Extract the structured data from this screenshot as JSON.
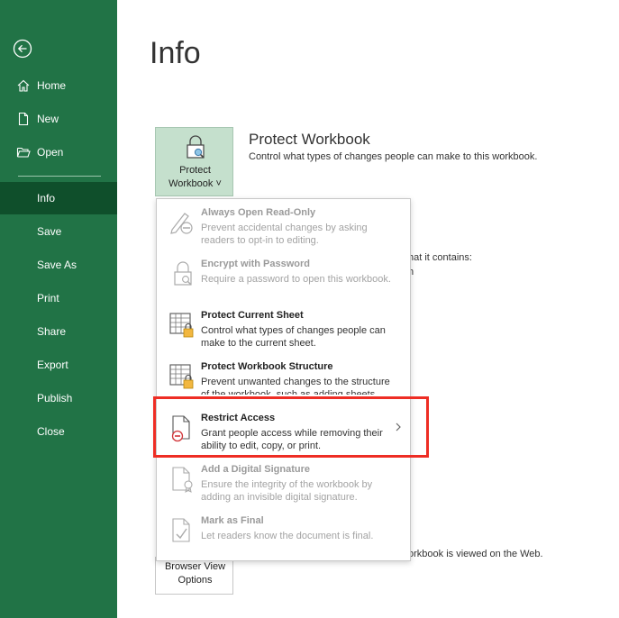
{
  "sidebar": {
    "items": [
      {
        "label": "Home",
        "icon": "home-icon"
      },
      {
        "label": "New",
        "icon": "new-document-icon"
      },
      {
        "label": "Open",
        "icon": "open-folder-icon"
      },
      {
        "label": "Info",
        "active": true
      },
      {
        "label": "Save"
      },
      {
        "label": "Save As"
      },
      {
        "label": "Print"
      },
      {
        "label": "Share"
      },
      {
        "label": "Export"
      },
      {
        "label": "Publish"
      },
      {
        "label": "Close"
      }
    ],
    "color": "#217346",
    "active_color": "#0f4f2b"
  },
  "page": {
    "title": "Info"
  },
  "protect": {
    "button_line1": "Protect",
    "button_line2": "Workbook ˅",
    "title": "Protect Workbook",
    "description": "Control what types of changes people can make to this workbook."
  },
  "background": {
    "text1": "hat it contains:",
    "text2": "h",
    "text3": "orkbook is viewed on the Web."
  },
  "browser_view": {
    "line1": "Browser View",
    "line2": "Options"
  },
  "menu": {
    "items": [
      {
        "title": "Always Open Read-Only",
        "desc": "Prevent accidental changes by asking readers to opt-in to editing.",
        "enabled": false,
        "icon": "pencil-no-icon"
      },
      {
        "title": "Encrypt with Password",
        "desc": "Require a password to open this workbook.",
        "enabled": false,
        "icon": "lock-key-icon"
      },
      {
        "title": "Protect Current Sheet",
        "desc": "Control what types of changes people can make to the current sheet.",
        "enabled": true,
        "icon": "sheet-lock-icon"
      },
      {
        "title": "Protect Workbook Structure",
        "desc": "Prevent unwanted changes to the structure of the workbook, such as adding sheets.",
        "enabled": true,
        "icon": "workbook-lock-icon"
      },
      {
        "title": "Restrict Access",
        "desc": "Grant people access while removing their ability to edit, copy, or print.",
        "enabled": true,
        "icon": "restrict-access-icon",
        "has_submenu": true
      },
      {
        "title": "Add a Digital Signature",
        "desc": "Ensure the integrity of the workbook by adding an invisible digital signature.",
        "enabled": false,
        "icon": "signature-icon"
      },
      {
        "title": "Mark as Final",
        "desc": "Let readers know the document is final.",
        "enabled": false,
        "icon": "mark-final-icon"
      }
    ]
  },
  "highlight_color": "#ee2d24"
}
